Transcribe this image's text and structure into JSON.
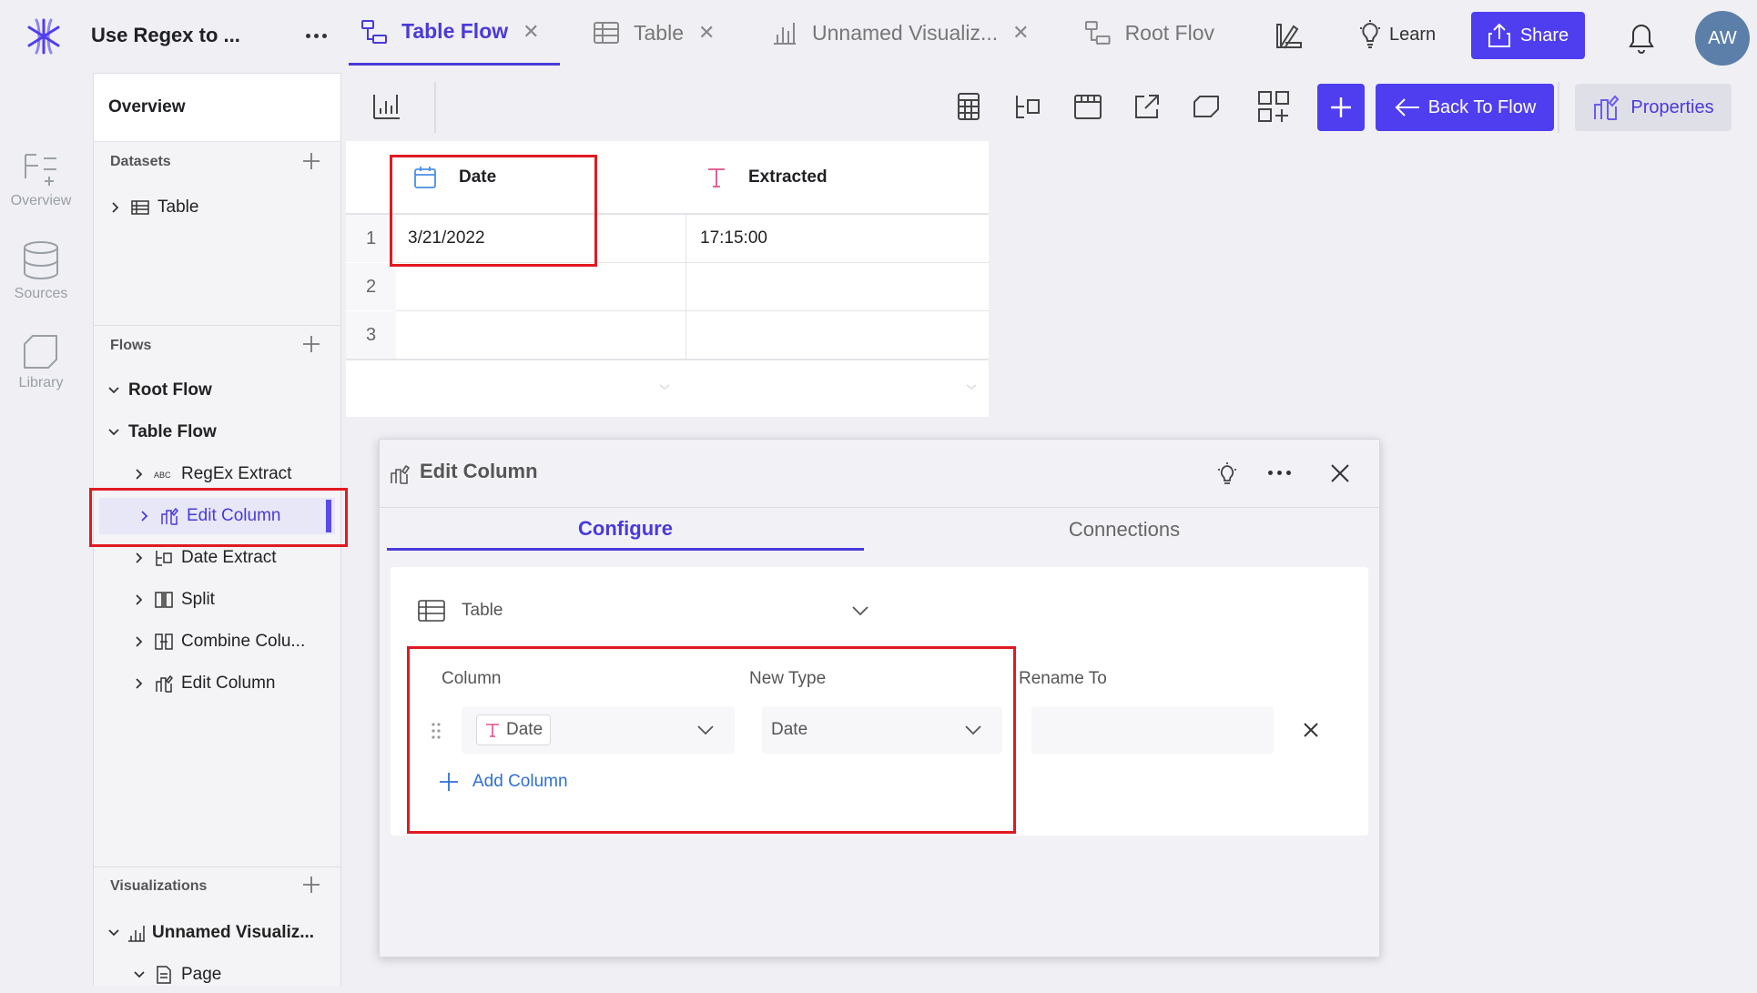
{
  "app": {
    "doc_title": "Use Regex to ...",
    "tabs": [
      {
        "label": "Table Flow",
        "active": true
      },
      {
        "label": "Table"
      },
      {
        "label": "Unnamed Visualiz..."
      },
      {
        "label": "Root Flov"
      }
    ],
    "learn_label": "Learn",
    "share_label": "Share",
    "avatar_initials": "AW",
    "accent": "#4f3ef0"
  },
  "rail": {
    "overview": "Overview",
    "sources": "Sources",
    "library": "Library"
  },
  "sidebar": {
    "title": "Overview",
    "datasets_label": "Datasets",
    "datasets": [
      {
        "label": "Table"
      }
    ],
    "flows_label": "Flows",
    "flows": [
      {
        "label": "Root Flow"
      },
      {
        "label": "Table Flow"
      }
    ],
    "flow_steps": [
      {
        "label": "RegEx Extract",
        "icon": "abc-icon"
      },
      {
        "label": "Edit Column",
        "icon": "edit-column-icon",
        "selected": true
      },
      {
        "label": "Date Extract",
        "icon": "date-extract-icon"
      },
      {
        "label": "Split",
        "icon": "split-icon"
      },
      {
        "label": "Combine Colu...",
        "icon": "combine-icon"
      },
      {
        "label": "Edit Column",
        "icon": "edit-column-icon"
      }
    ],
    "visualizations_label": "Visualizations",
    "visualizations": [
      {
        "label": "Unnamed Visualiz..."
      }
    ],
    "pages": [
      {
        "label": "Page"
      }
    ]
  },
  "toolbar": {
    "back_label": "Back To Flow",
    "properties_label": "Properties"
  },
  "grid": {
    "columns": [
      {
        "name": "Date",
        "type": "date"
      },
      {
        "name": "Extracted",
        "type": "text"
      }
    ],
    "rows": [
      {
        "n": "1",
        "cells": [
          "3/21/2022",
          "17:15:00"
        ]
      },
      {
        "n": "2",
        "cells": [
          "",
          ""
        ]
      },
      {
        "n": "3",
        "cells": [
          "",
          ""
        ]
      }
    ]
  },
  "dialog": {
    "title": "Edit Column",
    "tabs": [
      {
        "label": "Configure",
        "active": true
      },
      {
        "label": "Connections"
      }
    ],
    "source_table": "Table",
    "column_header": "Column",
    "new_type_header": "New Type",
    "rename_header": "Rename To",
    "column_value": "Date",
    "new_type_value": "Date",
    "rename_value": "",
    "add_column_label": "Add Column"
  }
}
